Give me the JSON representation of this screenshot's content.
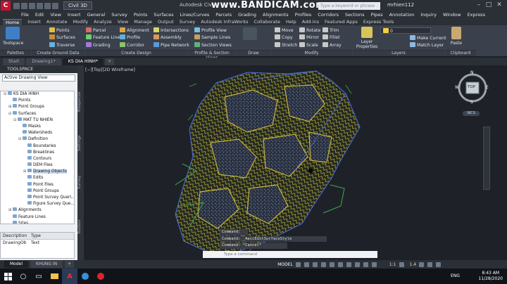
{
  "titlebar": {
    "logo": "C",
    "workspace": "Civil 3D",
    "app_title": "Autodesk Civ",
    "recorder_watermark": "www.BANDICAM.com",
    "search_placeholder": "Type a keyword or phrase",
    "user": "mrhien112",
    "min": "–",
    "max": "□",
    "close": "✕"
  },
  "menu": [
    "File",
    "Edit",
    "View",
    "Insert",
    "General",
    "Survey",
    "Points",
    "Surfaces",
    "Lines/Curves",
    "Parcels",
    "Grading",
    "Alignments",
    "Profiles",
    "Corridors",
    "Sections",
    "Pipes",
    "Annotation",
    "Inquiry",
    "Window",
    "Express"
  ],
  "ribbon_tabs": [
    "Home",
    "Insert",
    "Annotate",
    "Modify",
    "Analyze",
    "View",
    "Manage",
    "Output",
    "Survey",
    "Autodesk InfraWorks",
    "Collaborate",
    "Help",
    "Add-ins",
    "Featured Apps",
    "Express Tools"
  ],
  "ribbon": {
    "toolspace": "Toolspace",
    "groups": [
      {
        "label": "Palettes"
      },
      {
        "label": "Create Ground Data"
      },
      {
        "label": "Create Design"
      },
      {
        "label": "Profile & Section Views"
      },
      {
        "label": "Draw"
      },
      {
        "label": "Modify"
      },
      {
        "label": "Layers"
      },
      {
        "label": "Clipboard"
      }
    ],
    "ground": [
      "Points",
      "Surfaces",
      "Traverse"
    ],
    "ground2": [
      "Feature Line",
      "Grading"
    ],
    "design": [
      "Parcel",
      "Alignment",
      "Profile",
      "Corridor"
    ],
    "design2": [
      "Intersections",
      "Assembly",
      "Pipe Network"
    ],
    "profile": [
      "Profile View",
      "Sample Lines",
      "Section Views"
    ],
    "modify": [
      "Move",
      "Rotate",
      "Trim",
      "Copy",
      "Mirror",
      "Fillet",
      "Stretch",
      "Scale",
      "Array"
    ],
    "layers": [
      "Layer Properties",
      "Make Current",
      "Match Layer"
    ],
    "layer_value": "0",
    "paste": "Paste"
  },
  "doc_tabs": [
    "Start",
    "Drawing1*",
    "KS DIA HINH*"
  ],
  "toolspace": {
    "title": "TOOLSPACE",
    "view_select": "Active Drawing View",
    "tree": [
      {
        "label": "KS DIA HINH",
        "level": 0,
        "toggle": "⊟"
      },
      {
        "label": "Points",
        "level": 1,
        "toggle": ""
      },
      {
        "label": "Point Groups",
        "level": 1,
        "toggle": "⊞"
      },
      {
        "label": "Surfaces",
        "level": 1,
        "toggle": "⊟"
      },
      {
        "label": "MAT TU NHIEN",
        "level": 2,
        "toggle": "⊟"
      },
      {
        "label": "Masks",
        "level": 3,
        "toggle": ""
      },
      {
        "label": "Watersheds",
        "level": 3,
        "toggle": ""
      },
      {
        "label": "Definition",
        "level": 3,
        "toggle": "⊟"
      },
      {
        "label": "Boundaries",
        "level": 4,
        "toggle": ""
      },
      {
        "label": "Breaklines",
        "level": 4,
        "toggle": ""
      },
      {
        "label": "Contours",
        "level": 4,
        "toggle": ""
      },
      {
        "label": "DEM Files",
        "level": 4,
        "toggle": ""
      },
      {
        "label": "Drawing Objects",
        "level": 4,
        "toggle": "⊞",
        "selected": true
      },
      {
        "label": "Edits",
        "level": 4,
        "toggle": ""
      },
      {
        "label": "Point Files",
        "level": 4,
        "toggle": ""
      },
      {
        "label": "Point Groups",
        "level": 4,
        "toggle": ""
      },
      {
        "label": "Point Survey Queri...",
        "level": 4,
        "toggle": ""
      },
      {
        "label": "Figure Survey Que...",
        "level": 4,
        "toggle": ""
      },
      {
        "label": "Alignments",
        "level": 1,
        "toggle": "⊞"
      },
      {
        "label": "Feature Lines",
        "level": 1,
        "toggle": ""
      },
      {
        "label": "Sites",
        "level": 1,
        "toggle": ""
      }
    ],
    "props_headers": [
      "Description",
      "Type"
    ],
    "props_row": [
      "DrawingOb",
      "Text"
    ],
    "side_tabs": [
      "Prospector",
      "Settings",
      "Survey",
      "Toolbox"
    ]
  },
  "viewport": {
    "label": "[−][Top][2D Wireframe]",
    "viewcube": {
      "top": "TOP",
      "n": "N",
      "s": "S",
      "e": "E",
      "w": "W"
    },
    "wcs": "WCS"
  },
  "command": {
    "lines": [
      "Command:",
      "Command: _AeccEditSurfaceStyle",
      "Command: *Cancel*"
    ],
    "placeholder": "Type a command"
  },
  "status": {
    "layout_tabs": [
      "Model",
      "KHUNG IN",
      "+"
    ],
    "model": "MODEL",
    "scale": "1:1",
    "dims": "1.4"
  },
  "taskbar": {
    "time": "8:43 AM",
    "date": "11/28/2020",
    "lang": "ENG"
  },
  "colors": {
    "accent": "#c8102e",
    "contour": "#c8b43a",
    "blue_line": "#4a6fe0",
    "green_line": "#3fa84a"
  }
}
